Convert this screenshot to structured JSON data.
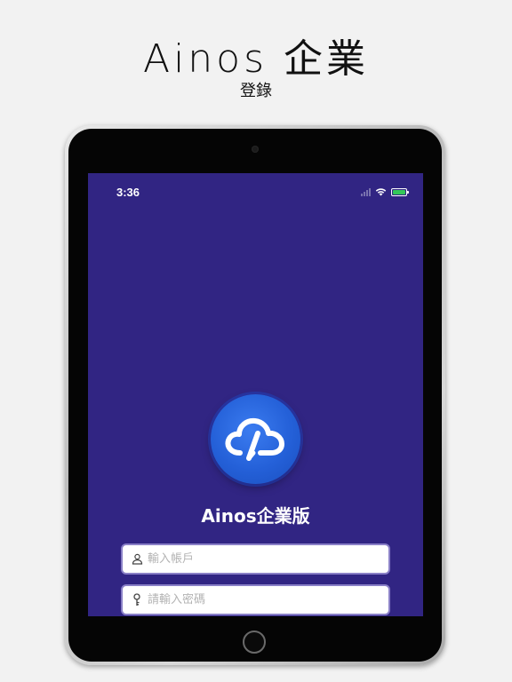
{
  "header": {
    "title": "Ainos 企業",
    "subtitle": "登錄"
  },
  "status_bar": {
    "time": "3:36",
    "battery_color": "#34c759"
  },
  "app": {
    "name": "Ainos企業版",
    "logo_icon": "cloud-logo-icon",
    "background_color": "#312583",
    "logo_color": "#2460d8"
  },
  "login": {
    "account_placeholder": "輸入帳戶",
    "account_value": "",
    "account_icon": "user-icon",
    "password_placeholder": "請輸入密碼",
    "password_value": "",
    "password_icon": "key-icon"
  }
}
